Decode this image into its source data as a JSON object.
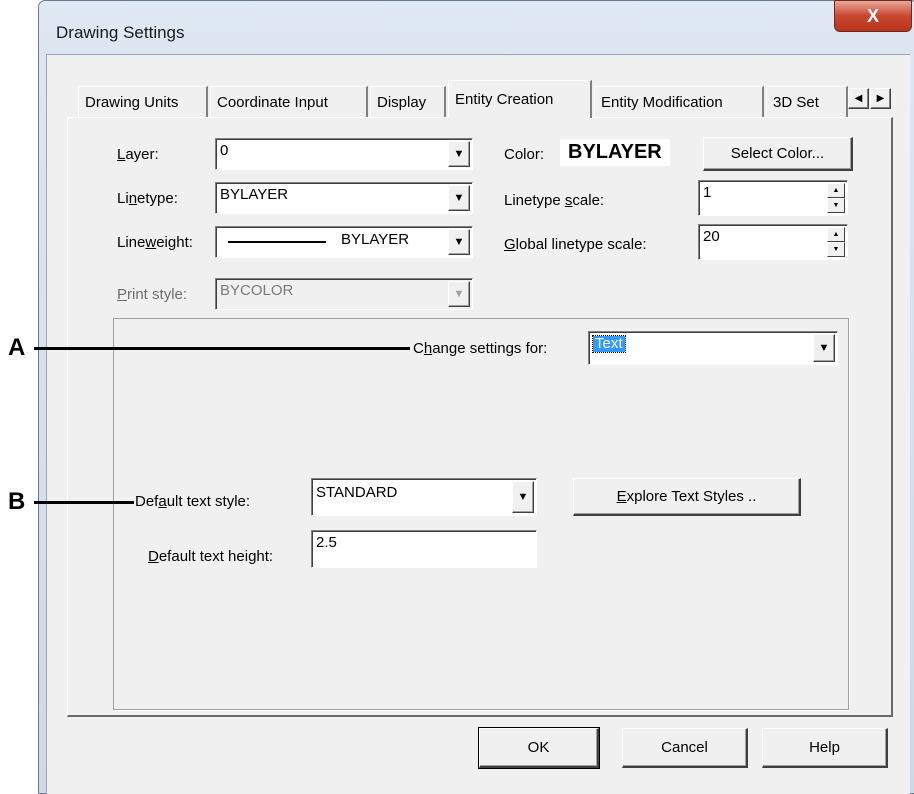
{
  "window": {
    "title": "Drawing Settings",
    "close_glyph": "X"
  },
  "tabs": [
    {
      "label": "Drawing Units"
    },
    {
      "label": "Coordinate Input"
    },
    {
      "label": "Display"
    },
    {
      "label": "Entity Creation"
    },
    {
      "label": "Entity Modification"
    },
    {
      "label": "3D Set"
    }
  ],
  "tab_scroll": {
    "left": "◀",
    "right": "▶"
  },
  "fields": {
    "layer": {
      "label_pre": "",
      "label_ul": "L",
      "label_post": "ayer:",
      "value": "0"
    },
    "linetype": {
      "label_pre": "Li",
      "label_ul": "n",
      "label_post": "etype:",
      "value": "BYLAYER"
    },
    "lineweight": {
      "label_pre": "Line",
      "label_ul": "w",
      "label_post": "eight:",
      "value": "BYLAYER"
    },
    "print_style": {
      "label_pre": "",
      "label_ul": "P",
      "label_post": "rint style:",
      "value": "BYCOLOR"
    },
    "color": {
      "label": "Color:",
      "value": "BYLAYER",
      "button": "Select Color..."
    },
    "linetype_scale": {
      "label_pre": "Linetype ",
      "label_ul": "s",
      "label_post": "cale:",
      "value": "1"
    },
    "global_linetype_scale": {
      "label_pre": "",
      "label_ul": "G",
      "label_post": "lobal linetype scale:",
      "value": "20"
    }
  },
  "settings": {
    "change_for": {
      "label_pre": "C",
      "label_ul": "h",
      "label_post": "ange settings for:",
      "value": "Text"
    },
    "default_text_style": {
      "label_pre": "Def",
      "label_ul": "a",
      "label_post": "ult text style:",
      "value": "STANDARD"
    },
    "explore_button": {
      "label_ul": "E",
      "label_post": "xplore Text Styles .."
    },
    "default_text_height": {
      "label_pre": "",
      "label_ul": "D",
      "label_post": "efault text height:",
      "value": "2.5"
    }
  },
  "footer": {
    "ok": "OK",
    "cancel": "Cancel",
    "help": "Help"
  },
  "annotations": {
    "a": "A",
    "b": "B"
  },
  "dropdown_glyph": "▼",
  "spin_glyphs": {
    "up": "▲",
    "down": "▼"
  }
}
